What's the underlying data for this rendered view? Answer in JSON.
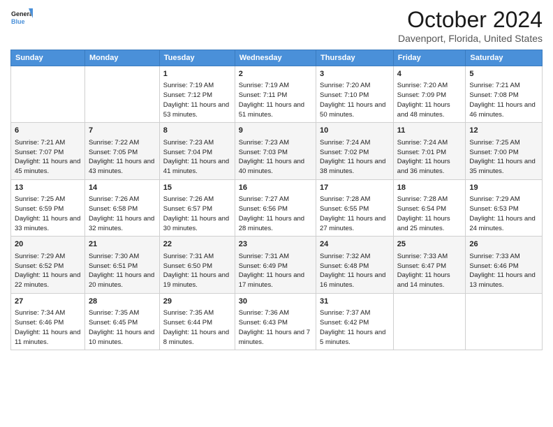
{
  "logo": {
    "line1": "General",
    "line2": "Blue"
  },
  "title": "October 2024",
  "subtitle": "Davenport, Florida, United States",
  "days_of_week": [
    "Sunday",
    "Monday",
    "Tuesday",
    "Wednesday",
    "Thursday",
    "Friday",
    "Saturday"
  ],
  "weeks": [
    [
      {
        "day": "",
        "info": ""
      },
      {
        "day": "",
        "info": ""
      },
      {
        "day": "1",
        "info": "Sunrise: 7:19 AM\nSunset: 7:12 PM\nDaylight: 11 hours and 53 minutes."
      },
      {
        "day": "2",
        "info": "Sunrise: 7:19 AM\nSunset: 7:11 PM\nDaylight: 11 hours and 51 minutes."
      },
      {
        "day": "3",
        "info": "Sunrise: 7:20 AM\nSunset: 7:10 PM\nDaylight: 11 hours and 50 minutes."
      },
      {
        "day": "4",
        "info": "Sunrise: 7:20 AM\nSunset: 7:09 PM\nDaylight: 11 hours and 48 minutes."
      },
      {
        "day": "5",
        "info": "Sunrise: 7:21 AM\nSunset: 7:08 PM\nDaylight: 11 hours and 46 minutes."
      }
    ],
    [
      {
        "day": "6",
        "info": "Sunrise: 7:21 AM\nSunset: 7:07 PM\nDaylight: 11 hours and 45 minutes."
      },
      {
        "day": "7",
        "info": "Sunrise: 7:22 AM\nSunset: 7:05 PM\nDaylight: 11 hours and 43 minutes."
      },
      {
        "day": "8",
        "info": "Sunrise: 7:23 AM\nSunset: 7:04 PM\nDaylight: 11 hours and 41 minutes."
      },
      {
        "day": "9",
        "info": "Sunrise: 7:23 AM\nSunset: 7:03 PM\nDaylight: 11 hours and 40 minutes."
      },
      {
        "day": "10",
        "info": "Sunrise: 7:24 AM\nSunset: 7:02 PM\nDaylight: 11 hours and 38 minutes."
      },
      {
        "day": "11",
        "info": "Sunrise: 7:24 AM\nSunset: 7:01 PM\nDaylight: 11 hours and 36 minutes."
      },
      {
        "day": "12",
        "info": "Sunrise: 7:25 AM\nSunset: 7:00 PM\nDaylight: 11 hours and 35 minutes."
      }
    ],
    [
      {
        "day": "13",
        "info": "Sunrise: 7:25 AM\nSunset: 6:59 PM\nDaylight: 11 hours and 33 minutes."
      },
      {
        "day": "14",
        "info": "Sunrise: 7:26 AM\nSunset: 6:58 PM\nDaylight: 11 hours and 32 minutes."
      },
      {
        "day": "15",
        "info": "Sunrise: 7:26 AM\nSunset: 6:57 PM\nDaylight: 11 hours and 30 minutes."
      },
      {
        "day": "16",
        "info": "Sunrise: 7:27 AM\nSunset: 6:56 PM\nDaylight: 11 hours and 28 minutes."
      },
      {
        "day": "17",
        "info": "Sunrise: 7:28 AM\nSunset: 6:55 PM\nDaylight: 11 hours and 27 minutes."
      },
      {
        "day": "18",
        "info": "Sunrise: 7:28 AM\nSunset: 6:54 PM\nDaylight: 11 hours and 25 minutes."
      },
      {
        "day": "19",
        "info": "Sunrise: 7:29 AM\nSunset: 6:53 PM\nDaylight: 11 hours and 24 minutes."
      }
    ],
    [
      {
        "day": "20",
        "info": "Sunrise: 7:29 AM\nSunset: 6:52 PM\nDaylight: 11 hours and 22 minutes."
      },
      {
        "day": "21",
        "info": "Sunrise: 7:30 AM\nSunset: 6:51 PM\nDaylight: 11 hours and 20 minutes."
      },
      {
        "day": "22",
        "info": "Sunrise: 7:31 AM\nSunset: 6:50 PM\nDaylight: 11 hours and 19 minutes."
      },
      {
        "day": "23",
        "info": "Sunrise: 7:31 AM\nSunset: 6:49 PM\nDaylight: 11 hours and 17 minutes."
      },
      {
        "day": "24",
        "info": "Sunrise: 7:32 AM\nSunset: 6:48 PM\nDaylight: 11 hours and 16 minutes."
      },
      {
        "day": "25",
        "info": "Sunrise: 7:33 AM\nSunset: 6:47 PM\nDaylight: 11 hours and 14 minutes."
      },
      {
        "day": "26",
        "info": "Sunrise: 7:33 AM\nSunset: 6:46 PM\nDaylight: 11 hours and 13 minutes."
      }
    ],
    [
      {
        "day": "27",
        "info": "Sunrise: 7:34 AM\nSunset: 6:46 PM\nDaylight: 11 hours and 11 minutes."
      },
      {
        "day": "28",
        "info": "Sunrise: 7:35 AM\nSunset: 6:45 PM\nDaylight: 11 hours and 10 minutes."
      },
      {
        "day": "29",
        "info": "Sunrise: 7:35 AM\nSunset: 6:44 PM\nDaylight: 11 hours and 8 minutes."
      },
      {
        "day": "30",
        "info": "Sunrise: 7:36 AM\nSunset: 6:43 PM\nDaylight: 11 hours and 7 minutes."
      },
      {
        "day": "31",
        "info": "Sunrise: 7:37 AM\nSunset: 6:42 PM\nDaylight: 11 hours and 5 minutes."
      },
      {
        "day": "",
        "info": ""
      },
      {
        "day": "",
        "info": ""
      }
    ]
  ]
}
